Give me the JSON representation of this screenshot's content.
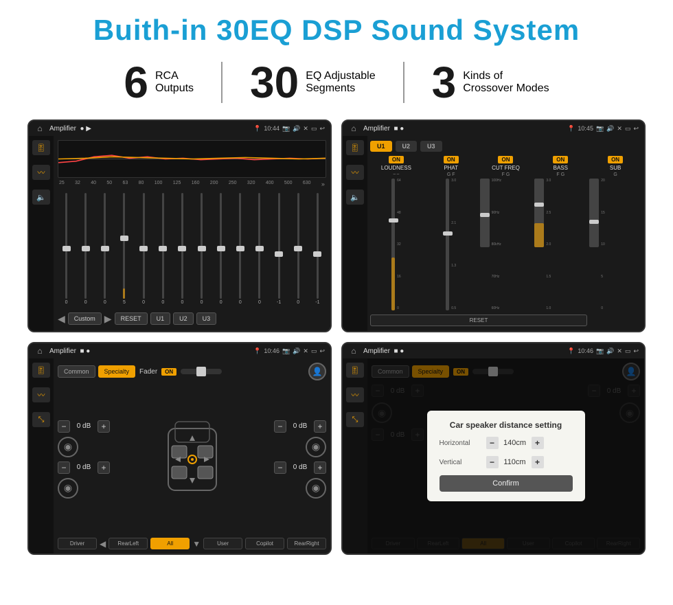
{
  "page": {
    "title": "Buith-in 30EQ DSP Sound System",
    "title_color": "#1a9fd4"
  },
  "stats": [
    {
      "number": "6",
      "label_line1": "RCA",
      "label_line2": "Outputs"
    },
    {
      "number": "30",
      "label_line1": "EQ Adjustable",
      "label_line2": "Segments"
    },
    {
      "number": "3",
      "label_line1": "Kinds of",
      "label_line2": "Crossover Modes"
    }
  ],
  "screen1": {
    "status_title": "Amplifier",
    "status_time": "10:44",
    "freq_labels": [
      "25",
      "32",
      "40",
      "50",
      "63",
      "80",
      "100",
      "125",
      "160",
      "200",
      "250",
      "320",
      "400",
      "500",
      "630"
    ],
    "eq_values": [
      "0",
      "0",
      "0",
      "5",
      "0",
      "0",
      "0",
      "0",
      "0",
      "0",
      "0",
      "-1",
      "0",
      "-1"
    ],
    "buttons": [
      "Custom",
      "RESET",
      "U1",
      "U2",
      "U3"
    ]
  },
  "screen2": {
    "status_title": "Amplifier",
    "status_time": "10:45",
    "presets": [
      "U1",
      "U2",
      "U3"
    ],
    "channels": [
      "LOUDNESS",
      "PHAT",
      "CUT FREQ",
      "BASS",
      "SUB"
    ],
    "on_labels": [
      "ON",
      "ON",
      "ON",
      "ON",
      "ON"
    ],
    "reset_label": "RESET"
  },
  "screen3": {
    "status_title": "Amplifier",
    "status_time": "10:46",
    "tabs": [
      "Common",
      "Specialty"
    ],
    "fader_label": "Fader",
    "fader_on": "ON",
    "db_values": [
      "0 dB",
      "0 dB",
      "0 dB",
      "0 dB"
    ],
    "buttons": [
      "Driver",
      "Copilot",
      "RearLeft",
      "All",
      "User",
      "RearRight"
    ]
  },
  "screen4": {
    "status_title": "Amplifier",
    "status_time": "10:46",
    "tabs": [
      "Common",
      "Specialty"
    ],
    "fader_on": "ON",
    "modal": {
      "title": "Car speaker distance setting",
      "horizontal_label": "Horizontal",
      "horizontal_value": "140cm",
      "vertical_label": "Vertical",
      "vertical_value": "110cm",
      "confirm_label": "Confirm"
    },
    "db_values": [
      "0 dB",
      "0 dB"
    ],
    "buttons": [
      "Driver",
      "Copilot",
      "RearLeft",
      "All",
      "User",
      "RearRight"
    ]
  }
}
